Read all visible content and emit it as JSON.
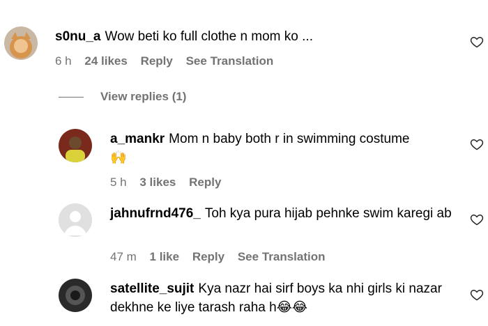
{
  "comments": [
    {
      "username": "s0nu_a",
      "text": "Wow beti ko full clothe n mom ko ...",
      "time": "6 h",
      "likes": "24 likes",
      "reply": "Reply",
      "translation": "See Translation"
    },
    {
      "username": "a_mankr",
      "text": "Mom n baby both r in swimming costume",
      "emoji": "🙌",
      "time": "5 h",
      "likes": "3 likes",
      "reply": "Reply"
    },
    {
      "username": "jahnufrnd476_",
      "text": "Toh kya pura hijab pehnke swim karegi ab",
      "time": "47 m",
      "likes": "1 like",
      "reply": "Reply",
      "translation": "See Translation"
    },
    {
      "username": "satellite_sujit",
      "text": "Kya nazr hai sirf boys ka nhi girls ki nazar dekhne ke liye tarash raha h",
      "emoji": "😂😂"
    }
  ],
  "view_replies": "View replies (1)",
  "icons": {
    "like": "heart-outline-icon",
    "placeholder_avatar": "default-avatar-icon"
  },
  "colors": {
    "meta": "#737373",
    "text": "#000000"
  }
}
